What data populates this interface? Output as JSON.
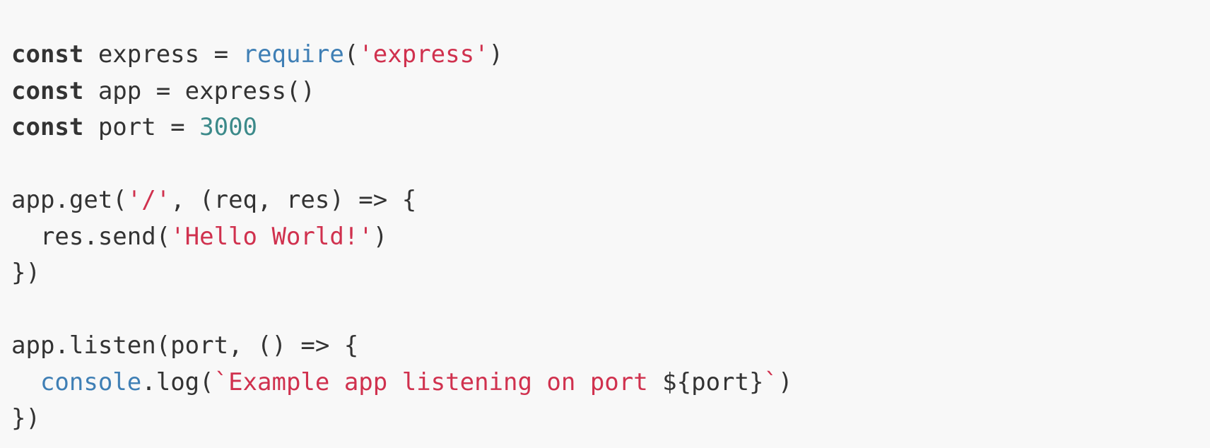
{
  "colors": {
    "background": "#f8f8f8",
    "text": "#333333",
    "keyword": "#333333",
    "builtin": "#3f7fb5",
    "string": "#d0314e",
    "number": "#3c8a8a"
  },
  "code": {
    "language": "javascript",
    "lines": [
      [
        {
          "t": "keyword",
          "v": "const"
        },
        {
          "t": "plain",
          "v": " express = "
        },
        {
          "t": "builtin",
          "v": "require"
        },
        {
          "t": "plain",
          "v": "("
        },
        {
          "t": "string",
          "v": "'express'"
        },
        {
          "t": "plain",
          "v": ")"
        }
      ],
      [
        {
          "t": "keyword",
          "v": "const"
        },
        {
          "t": "plain",
          "v": " app = express()"
        }
      ],
      [
        {
          "t": "keyword",
          "v": "const"
        },
        {
          "t": "plain",
          "v": " port = "
        },
        {
          "t": "number",
          "v": "3000"
        }
      ],
      [],
      [
        {
          "t": "plain",
          "v": "app.get("
        },
        {
          "t": "string",
          "v": "'/'"
        },
        {
          "t": "plain",
          "v": ", (req, res) => {"
        }
      ],
      [
        {
          "t": "plain",
          "v": "  res.send("
        },
        {
          "t": "string",
          "v": "'Hello World!'"
        },
        {
          "t": "plain",
          "v": ")"
        }
      ],
      [
        {
          "t": "plain",
          "v": "})"
        }
      ],
      [],
      [
        {
          "t": "plain",
          "v": "app.listen(port, () => {"
        }
      ],
      [
        {
          "t": "plain",
          "v": "  "
        },
        {
          "t": "builtin",
          "v": "console"
        },
        {
          "t": "plain",
          "v": ".log("
        },
        {
          "t": "string",
          "v": "`Example app listening on port "
        },
        {
          "t": "plain",
          "v": "${port}"
        },
        {
          "t": "string",
          "v": "`"
        },
        {
          "t": "plain",
          "v": ")"
        }
      ],
      [
        {
          "t": "plain",
          "v": "})"
        }
      ]
    ]
  }
}
